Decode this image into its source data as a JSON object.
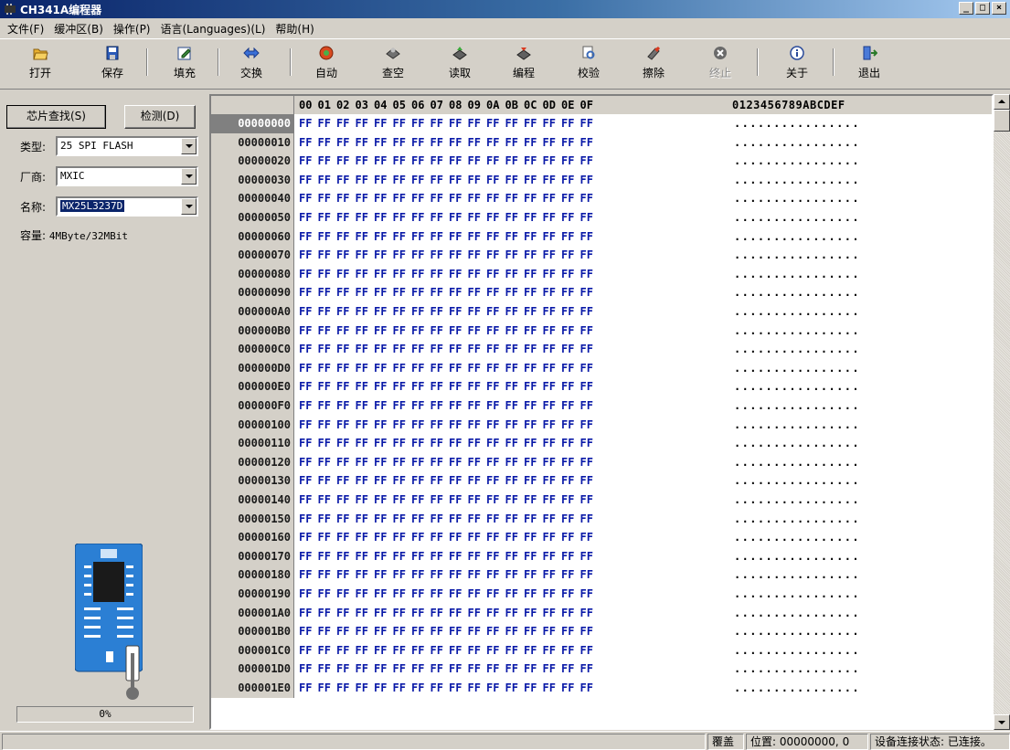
{
  "window": {
    "title": "CH341A编程器",
    "minimize": "_",
    "maximize": "□",
    "close": "×"
  },
  "menu": [
    "文件(F)",
    "缓冲区(B)",
    "操作(P)",
    "语言(Languages)(L)",
    "帮助(H)"
  ],
  "toolbar": {
    "open": "打开",
    "save": "保存",
    "fill": "填充",
    "swap": "交换",
    "auto": "自动",
    "blank_check": "查空",
    "read": "读取",
    "program": "编程",
    "verify": "校验",
    "erase": "擦除",
    "stop": "终止",
    "about": "关于",
    "exit": "退出"
  },
  "left_panel": {
    "chip_search_button": "芯片查找(S)",
    "detect_button": "检测(D)",
    "type_label": "类型:",
    "type_value": "25 SPI FLASH",
    "vendor_label": "厂商:",
    "vendor_value": "MXIC",
    "name_label": "名称:",
    "name_value": "MX25L3237D",
    "capacity_label": "容量:",
    "capacity_value": "4MByte/32MBit",
    "progress_text": "0%",
    "progress_value": 0
  },
  "hex": {
    "columns": [
      "00",
      "01",
      "02",
      "03",
      "04",
      "05",
      "06",
      "07",
      "08",
      "09",
      "0A",
      "0B",
      "0C",
      "0D",
      "0E",
      "0F"
    ],
    "ascii_header": "0123456789ABCDEF",
    "rows": [
      {
        "addr": "00000000",
        "bytes": [
          "FF",
          "FF",
          "FF",
          "FF",
          "FF",
          "FF",
          "FF",
          "FF",
          "FF",
          "FF",
          "FF",
          "FF",
          "FF",
          "FF",
          "FF",
          "FF"
        ],
        "ascii": "................"
      },
      {
        "addr": "00000010",
        "bytes": [
          "FF",
          "FF",
          "FF",
          "FF",
          "FF",
          "FF",
          "FF",
          "FF",
          "FF",
          "FF",
          "FF",
          "FF",
          "FF",
          "FF",
          "FF",
          "FF"
        ],
        "ascii": "................"
      },
      {
        "addr": "00000020",
        "bytes": [
          "FF",
          "FF",
          "FF",
          "FF",
          "FF",
          "FF",
          "FF",
          "FF",
          "FF",
          "FF",
          "FF",
          "FF",
          "FF",
          "FF",
          "FF",
          "FF"
        ],
        "ascii": "................"
      },
      {
        "addr": "00000030",
        "bytes": [
          "FF",
          "FF",
          "FF",
          "FF",
          "FF",
          "FF",
          "FF",
          "FF",
          "FF",
          "FF",
          "FF",
          "FF",
          "FF",
          "FF",
          "FF",
          "FF"
        ],
        "ascii": "................"
      },
      {
        "addr": "00000040",
        "bytes": [
          "FF",
          "FF",
          "FF",
          "FF",
          "FF",
          "FF",
          "FF",
          "FF",
          "FF",
          "FF",
          "FF",
          "FF",
          "FF",
          "FF",
          "FF",
          "FF"
        ],
        "ascii": "................"
      },
      {
        "addr": "00000050",
        "bytes": [
          "FF",
          "FF",
          "FF",
          "FF",
          "FF",
          "FF",
          "FF",
          "FF",
          "FF",
          "FF",
          "FF",
          "FF",
          "FF",
          "FF",
          "FF",
          "FF"
        ],
        "ascii": "................"
      },
      {
        "addr": "00000060",
        "bytes": [
          "FF",
          "FF",
          "FF",
          "FF",
          "FF",
          "FF",
          "FF",
          "FF",
          "FF",
          "FF",
          "FF",
          "FF",
          "FF",
          "FF",
          "FF",
          "FF"
        ],
        "ascii": "................"
      },
      {
        "addr": "00000070",
        "bytes": [
          "FF",
          "FF",
          "FF",
          "FF",
          "FF",
          "FF",
          "FF",
          "FF",
          "FF",
          "FF",
          "FF",
          "FF",
          "FF",
          "FF",
          "FF",
          "FF"
        ],
        "ascii": "................"
      },
      {
        "addr": "00000080",
        "bytes": [
          "FF",
          "FF",
          "FF",
          "FF",
          "FF",
          "FF",
          "FF",
          "FF",
          "FF",
          "FF",
          "FF",
          "FF",
          "FF",
          "FF",
          "FF",
          "FF"
        ],
        "ascii": "................"
      },
      {
        "addr": "00000090",
        "bytes": [
          "FF",
          "FF",
          "FF",
          "FF",
          "FF",
          "FF",
          "FF",
          "FF",
          "FF",
          "FF",
          "FF",
          "FF",
          "FF",
          "FF",
          "FF",
          "FF"
        ],
        "ascii": "................"
      },
      {
        "addr": "000000A0",
        "bytes": [
          "FF",
          "FF",
          "FF",
          "FF",
          "FF",
          "FF",
          "FF",
          "FF",
          "FF",
          "FF",
          "FF",
          "FF",
          "FF",
          "FF",
          "FF",
          "FF"
        ],
        "ascii": "................"
      },
      {
        "addr": "000000B0",
        "bytes": [
          "FF",
          "FF",
          "FF",
          "FF",
          "FF",
          "FF",
          "FF",
          "FF",
          "FF",
          "FF",
          "FF",
          "FF",
          "FF",
          "FF",
          "FF",
          "FF"
        ],
        "ascii": "................"
      },
      {
        "addr": "000000C0",
        "bytes": [
          "FF",
          "FF",
          "FF",
          "FF",
          "FF",
          "FF",
          "FF",
          "FF",
          "FF",
          "FF",
          "FF",
          "FF",
          "FF",
          "FF",
          "FF",
          "FF"
        ],
        "ascii": "................"
      },
      {
        "addr": "000000D0",
        "bytes": [
          "FF",
          "FF",
          "FF",
          "FF",
          "FF",
          "FF",
          "FF",
          "FF",
          "FF",
          "FF",
          "FF",
          "FF",
          "FF",
          "FF",
          "FF",
          "FF"
        ],
        "ascii": "................"
      },
      {
        "addr": "000000E0",
        "bytes": [
          "FF",
          "FF",
          "FF",
          "FF",
          "FF",
          "FF",
          "FF",
          "FF",
          "FF",
          "FF",
          "FF",
          "FF",
          "FF",
          "FF",
          "FF",
          "FF"
        ],
        "ascii": "................"
      },
      {
        "addr": "000000F0",
        "bytes": [
          "FF",
          "FF",
          "FF",
          "FF",
          "FF",
          "FF",
          "FF",
          "FF",
          "FF",
          "FF",
          "FF",
          "FF",
          "FF",
          "FF",
          "FF",
          "FF"
        ],
        "ascii": "................"
      },
      {
        "addr": "00000100",
        "bytes": [
          "FF",
          "FF",
          "FF",
          "FF",
          "FF",
          "FF",
          "FF",
          "FF",
          "FF",
          "FF",
          "FF",
          "FF",
          "FF",
          "FF",
          "FF",
          "FF"
        ],
        "ascii": "................"
      },
      {
        "addr": "00000110",
        "bytes": [
          "FF",
          "FF",
          "FF",
          "FF",
          "FF",
          "FF",
          "FF",
          "FF",
          "FF",
          "FF",
          "FF",
          "FF",
          "FF",
          "FF",
          "FF",
          "FF"
        ],
        "ascii": "................"
      },
      {
        "addr": "00000120",
        "bytes": [
          "FF",
          "FF",
          "FF",
          "FF",
          "FF",
          "FF",
          "FF",
          "FF",
          "FF",
          "FF",
          "FF",
          "FF",
          "FF",
          "FF",
          "FF",
          "FF"
        ],
        "ascii": "................"
      },
      {
        "addr": "00000130",
        "bytes": [
          "FF",
          "FF",
          "FF",
          "FF",
          "FF",
          "FF",
          "FF",
          "FF",
          "FF",
          "FF",
          "FF",
          "FF",
          "FF",
          "FF",
          "FF",
          "FF"
        ],
        "ascii": "................"
      },
      {
        "addr": "00000140",
        "bytes": [
          "FF",
          "FF",
          "FF",
          "FF",
          "FF",
          "FF",
          "FF",
          "FF",
          "FF",
          "FF",
          "FF",
          "FF",
          "FF",
          "FF",
          "FF",
          "FF"
        ],
        "ascii": "................"
      },
      {
        "addr": "00000150",
        "bytes": [
          "FF",
          "FF",
          "FF",
          "FF",
          "FF",
          "FF",
          "FF",
          "FF",
          "FF",
          "FF",
          "FF",
          "FF",
          "FF",
          "FF",
          "FF",
          "FF"
        ],
        "ascii": "................"
      },
      {
        "addr": "00000160",
        "bytes": [
          "FF",
          "FF",
          "FF",
          "FF",
          "FF",
          "FF",
          "FF",
          "FF",
          "FF",
          "FF",
          "FF",
          "FF",
          "FF",
          "FF",
          "FF",
          "FF"
        ],
        "ascii": "................"
      },
      {
        "addr": "00000170",
        "bytes": [
          "FF",
          "FF",
          "FF",
          "FF",
          "FF",
          "FF",
          "FF",
          "FF",
          "FF",
          "FF",
          "FF",
          "FF",
          "FF",
          "FF",
          "FF",
          "FF"
        ],
        "ascii": "................"
      },
      {
        "addr": "00000180",
        "bytes": [
          "FF",
          "FF",
          "FF",
          "FF",
          "FF",
          "FF",
          "FF",
          "FF",
          "FF",
          "FF",
          "FF",
          "FF",
          "FF",
          "FF",
          "FF",
          "FF"
        ],
        "ascii": "................"
      },
      {
        "addr": "00000190",
        "bytes": [
          "FF",
          "FF",
          "FF",
          "FF",
          "FF",
          "FF",
          "FF",
          "FF",
          "FF",
          "FF",
          "FF",
          "FF",
          "FF",
          "FF",
          "FF",
          "FF"
        ],
        "ascii": "................"
      },
      {
        "addr": "000001A0",
        "bytes": [
          "FF",
          "FF",
          "FF",
          "FF",
          "FF",
          "FF",
          "FF",
          "FF",
          "FF",
          "FF",
          "FF",
          "FF",
          "FF",
          "FF",
          "FF",
          "FF"
        ],
        "ascii": "................"
      },
      {
        "addr": "000001B0",
        "bytes": [
          "FF",
          "FF",
          "FF",
          "FF",
          "FF",
          "FF",
          "FF",
          "FF",
          "FF",
          "FF",
          "FF",
          "FF",
          "FF",
          "FF",
          "FF",
          "FF"
        ],
        "ascii": "................"
      },
      {
        "addr": "000001C0",
        "bytes": [
          "FF",
          "FF",
          "FF",
          "FF",
          "FF",
          "FF",
          "FF",
          "FF",
          "FF",
          "FF",
          "FF",
          "FF",
          "FF",
          "FF",
          "FF",
          "FF"
        ],
        "ascii": "................"
      },
      {
        "addr": "000001D0",
        "bytes": [
          "FF",
          "FF",
          "FF",
          "FF",
          "FF",
          "FF",
          "FF",
          "FF",
          "FF",
          "FF",
          "FF",
          "FF",
          "FF",
          "FF",
          "FF",
          "FF"
        ],
        "ascii": "................"
      },
      {
        "addr": "000001E0",
        "bytes": [
          "FF",
          "FF",
          "FF",
          "FF",
          "FF",
          "FF",
          "FF",
          "FF",
          "FF",
          "FF",
          "FF",
          "FF",
          "FF",
          "FF",
          "FF",
          "FF"
        ],
        "ascii": "................"
      }
    ]
  },
  "status": {
    "mode": "覆盖",
    "position": "位置: 00000000, 0",
    "connection": "设备连接状态: 已连接。"
  },
  "colors": {
    "hex_bytes": "#0a1aa8",
    "title_bar": "#0a246a",
    "chip_board": "#2b7fd4"
  }
}
